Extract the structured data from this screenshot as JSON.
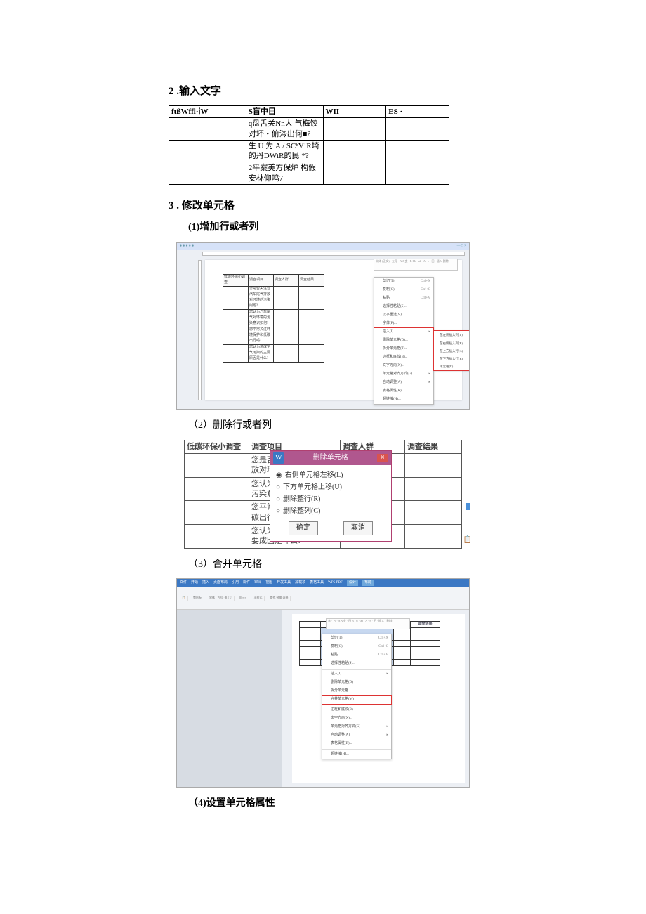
{
  "s2": {
    "title": "2 .输入文字",
    "table": {
      "headers": [
        "ftßWffl·ⅰW",
        "S盲中目",
        "WII",
        "ES ·"
      ],
      "rows": [
        [
          "",
          "q盘舌关Nn人 气梅饺对坏・俯涔出何■?",
          "",
          ""
        ],
        [
          "",
          "生 U 为 A / SCᵇV!R埼的丹DWtR的民 *?",
          "",
          ""
        ],
        [
          "",
          "2平案美方保炉   构假安林仰鸣7",
          "",
          ""
        ]
      ]
    }
  },
  "s3": {
    "title": "3 . 修改单元格",
    "sub1": {
      "title": "(1)增加行或者列",
      "shot": {
        "caption": "",
        "mini_toolbar": "宋体 (正文)    · 五号  · A  A  变 ·\nB  I  U · ab · A ·  ≡ · 田 · 插入  删除",
        "mini_table_headers": [
          "低碳环保小调查",
          "调查项目",
          "调查人群",
          "调查结果"
        ],
        "mini_table_rows": [
          "您是否关注过汽车尾气排放对环境的污染问题?",
          "您认为汽车尾气对环境的污染意识如何?",
          "您平常关注环境保护和低碳出行吗?",
          "您认为造成空气污染的主要原因是什么?"
        ],
        "ctx": [
          {
            "label": "剪切(T)",
            "hint": "Ctrl+X"
          },
          {
            "label": "复制(C)",
            "hint": "Ctrl+C"
          },
          {
            "label": "粘贴",
            "hint": "Ctrl+V"
          },
          {
            "label": "选择性粘贴(S)...",
            "hint": ""
          },
          {
            "label": "汉字重选(V)",
            "hint": ""
          },
          {
            "label": "字体(F)...",
            "hint": ""
          },
          {
            "label": "插入(I)",
            "hint": "▸",
            "insert": true
          },
          {
            "label": "删除单元格(D)...",
            "hint": ""
          },
          {
            "label": "拆分单元格(T)...",
            "hint": ""
          },
          {
            "label": "边框和底纹(B)...",
            "hint": ""
          },
          {
            "label": "文字方向(X)...",
            "hint": ""
          },
          {
            "label": "单元格对齐方式(G)",
            "hint": "▸"
          },
          {
            "label": "自动调整(A)",
            "hint": "▸"
          },
          {
            "label": "表格属性(R)...",
            "hint": ""
          },
          {
            "label": "超链接(H)...",
            "hint": ""
          }
        ],
        "submenu": [
          "在左侧插入列(L)",
          "在右侧插入列(R)",
          "在上方插入行(A)",
          "在下方插入行(B)",
          "单元格(E)..."
        ]
      }
    },
    "sub2": {
      "title": "（2）删除行或者列",
      "table": {
        "headers": [
          "低碳环保小调查",
          "调查项目",
          "调查人群",
          "调查结果"
        ],
        "rows": [
          [
            "",
            "您是否关注过汽车尾气排放对环境的污染问题?",
            "",
            ""
          ],
          [
            "",
            "您认为汽车尾气对环境的污染意识如何?",
            "",
            ""
          ],
          [
            "",
            "您平常关注环境保护和低碳出行吗?",
            "",
            ""
          ],
          [
            "",
            "您认为造成空气污染的主要成因是什么?",
            "",
            ""
          ]
        ]
      },
      "dialog": {
        "title": "删除单元格",
        "icon_label": "W",
        "options": [
          "右侧单元格左移(L)",
          "下方单元格上移(U)",
          "删除整行(R)",
          "删除整列(C)"
        ],
        "ok": "确定",
        "cancel": "取消"
      },
      "clip": "📋"
    },
    "sub3": {
      "title": "（3）合并单元格",
      "shot": {
        "tabs": [
          "文件",
          "开始",
          "插入",
          "页面布局",
          "引用",
          "邮件",
          "审阅",
          "视图",
          "开发工具",
          "加载项",
          "表格工具",
          "WPS PDF"
        ],
        "tabs_ctx": [
          "设计",
          "布局"
        ],
        "groups_line": "粘贴  剪贴板  |  宋体  字体  |  段落  |  样式  |  编辑",
        "mini_toolbar": "宋  · 五 · A  A  变 ·  田\nB  I  U · ab · A · ≡ · 田 · 插入 · 删除",
        "mini_table_header": "调查结果",
        "ctx": [
          {
            "label": "剪切(T)",
            "hint": "Ctrl+X"
          },
          {
            "label": "复制(C)",
            "hint": "Ctrl+C"
          },
          {
            "label": "粘贴",
            "hint": "Ctrl+V"
          },
          {
            "label": "选择性粘贴(S)...",
            "hint": ""
          },
          {
            "sep": true
          },
          {
            "label": "插入(I)",
            "hint": "▸"
          },
          {
            "label": "删除单元格(D)",
            "hint": ""
          },
          {
            "label": "拆分单元格...",
            "hint": ""
          },
          {
            "label": "合并单元格(M)",
            "hint": "",
            "merge": true
          },
          {
            "sep": true
          },
          {
            "label": "边框和底纹(B)...",
            "hint": ""
          },
          {
            "label": "文字方向(X)...",
            "hint": ""
          },
          {
            "label": "单元格对齐方式(G)",
            "hint": "▸"
          },
          {
            "label": "自动调整(A)",
            "hint": "▸"
          },
          {
            "label": "表格属性(R)...",
            "hint": ""
          },
          {
            "sep": true
          },
          {
            "label": "超链接(H)...",
            "hint": ""
          }
        ]
      }
    },
    "sub4": {
      "title": "（4)设置单元格属性"
    }
  }
}
